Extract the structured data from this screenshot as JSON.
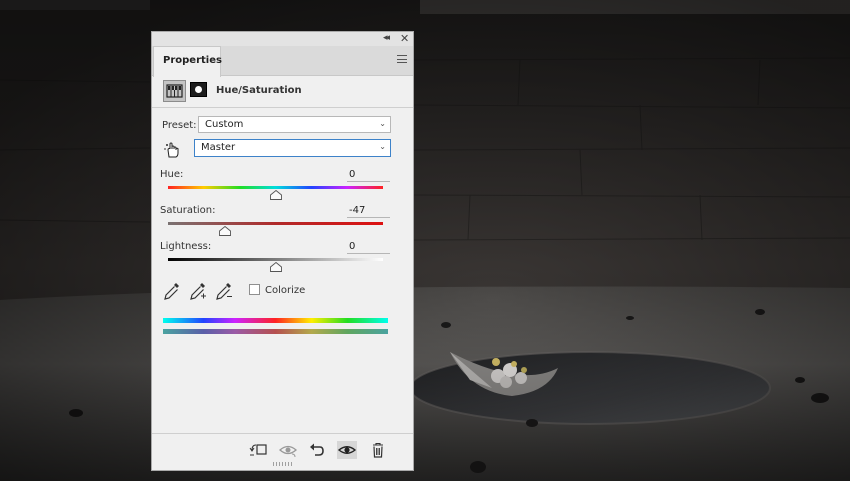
{
  "panel": {
    "tab_label": "Properties",
    "adjustment_title": "Hue/Saturation",
    "preset": {
      "label": "Preset:",
      "value": "Custom"
    },
    "channel": {
      "value": "Master"
    },
    "hue": {
      "label": "Hue:",
      "value": "0",
      "level": 0.5
    },
    "saturation": {
      "label": "Saturation:",
      "value": "-47",
      "level": 0.265
    },
    "lightness": {
      "label": "Lightness:",
      "value": "0",
      "level": 0.5
    },
    "colorize": {
      "label": "Colorize",
      "checked": false
    }
  },
  "icons": {
    "collapse": "double-chevron-left-icon",
    "close": "close-icon",
    "menu": "panel-menu-icon",
    "targeted_adjustment": "hand-icon",
    "eyedropper": "eyedropper-icon",
    "eyedropper_add": "eyedropper-plus-icon",
    "eyedropper_subtract": "eyedropper-minus-icon",
    "clip_to_layer": "clip-to-layer-icon",
    "view_previous": "view-previous-icon",
    "reset": "reset-icon",
    "visibility": "eye-icon",
    "delete": "trash-icon"
  },
  "colors": {
    "panel_bg": "#f0f0f0",
    "focus_border": "#3d82c9",
    "scene_dark": "#2a2827"
  }
}
